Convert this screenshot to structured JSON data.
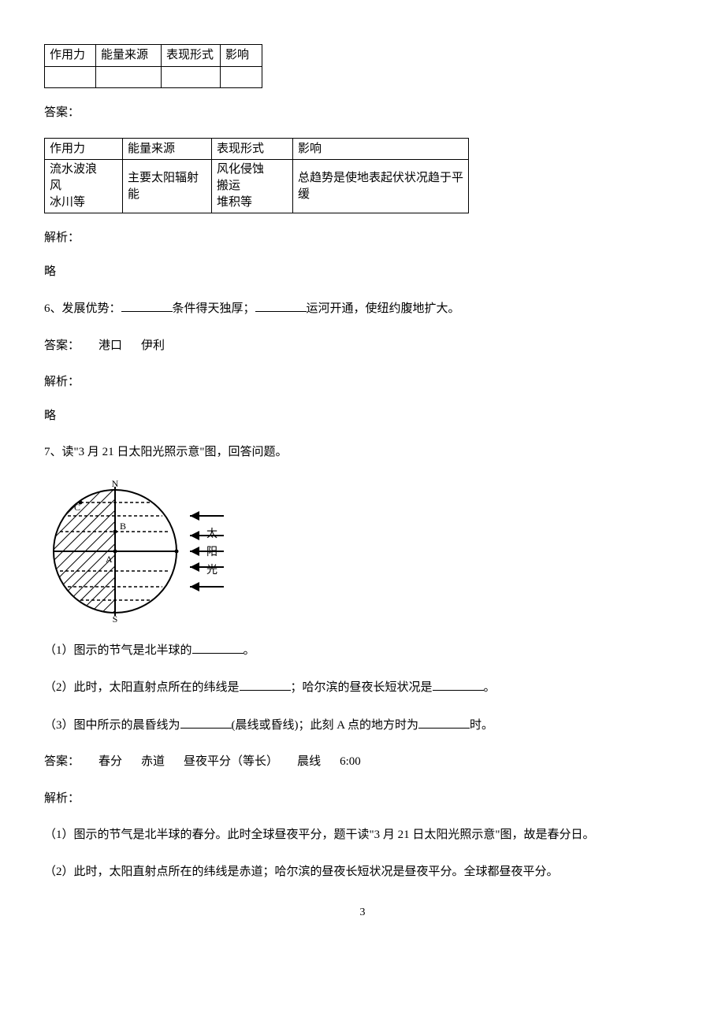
{
  "table1": {
    "headers": [
      "作用力",
      "能量来源",
      "表现形式",
      "影响"
    ]
  },
  "answer1_label": "答案：",
  "table2": {
    "headers": [
      "作用力",
      "能量来源",
      "表现形式",
      "影响"
    ],
    "row": {
      "c1": "流水波浪\n风\n冰川等",
      "c2": "主要太阳辐射能",
      "c3": "风化侵蚀\n搬运\n堆积等",
      "c4": "总趋势是使地表起伏状况趋于平缓"
    }
  },
  "analysis_label": "解析：",
  "omit": "略",
  "q6": {
    "prefix": "6、发展优势：",
    "mid1": "条件得天独厚；",
    "mid2": "运河开通，使纽约腹地扩大。"
  },
  "a6": {
    "label": "答案：",
    "v1": "港口",
    "v2": "伊利"
  },
  "q7": {
    "stem": "7、读\"3 月 21 日太阳光照示意\"图，回答问题。",
    "fig": {
      "n": "N",
      "s": "S",
      "a": "A",
      "b": "B",
      "c": "C",
      "lab1": "太",
      "lab2": "阳",
      "lab3": "光"
    },
    "p1a": "（1）图示的节气是北半球的",
    "p1b": "。",
    "p2a": "（2）此时，太阳直射点所在的纬线是",
    "p2b": "；哈尔滨的昼夜长短状况是",
    "p2c": "。",
    "p3a": "（3）图中所示的晨昏线为",
    "p3b": "(晨线或昏线)；此刻 A 点的地方时为",
    "p3c": "时。"
  },
  "a7": {
    "label": "答案：",
    "v1": "春分",
    "v2": "赤道",
    "v3": "昼夜平分（等长）",
    "v4": "晨线",
    "v5": "6:00"
  },
  "exp7": {
    "p1": "（1）图示的节气是北半球的春分。此时全球昼夜平分，题干读\"3 月 21 日太阳光照示意\"图，故是春分日。",
    "p2": "（2）此时，太阳直射点所在的纬线是赤道；哈尔滨的昼夜长短状况是昼夜平分。全球都昼夜平分。"
  },
  "page_number": "3"
}
